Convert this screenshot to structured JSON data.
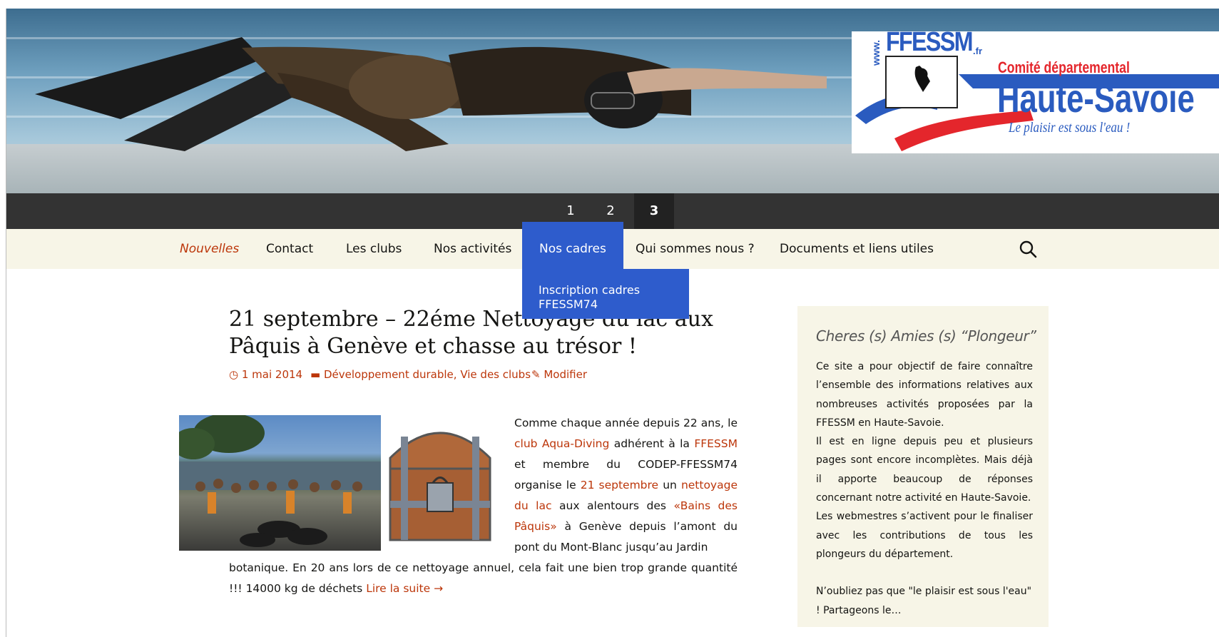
{
  "header": {
    "logo": {
      "brand": "FFESSM",
      "brand_suffix": ".fr",
      "www": "www.",
      "committee": "Comité départemental",
      "region": "Haute-Savoie",
      "slogan": "Le plaisir est sous l'eau !"
    }
  },
  "slider": {
    "pages": [
      "1",
      "2",
      "3"
    ],
    "active_index": 2
  },
  "nav": {
    "items": [
      {
        "label": "Nouvelles"
      },
      {
        "label": "Contact"
      },
      {
        "label": "Les clubs"
      },
      {
        "label": "Nos activités"
      },
      {
        "label": "Nos cadres"
      },
      {
        "label": "Qui sommes nous ?"
      },
      {
        "label": "Documents et liens utiles"
      }
    ],
    "dropdown": {
      "items": [
        {
          "label": "Inscription cadres FFESSM74"
        }
      ]
    }
  },
  "article": {
    "title": "21 septembre – 22éme Nettoyage du lac aux Pâquis à Genève et chasse au trésor !",
    "date": "1 mai 2014",
    "categories": [
      "Développement durable",
      "Vie des clubs"
    ],
    "edit_label": "Modifier",
    "text": {
      "p1": "Comme chaque année depuis 22 ans, le",
      "club_link": "club Aqua-Diving",
      "p2": " adhérent à la ",
      "ffessm_link": "FFESSM",
      "p3": " et membre du CODEP-FFESSM74 organise le ",
      "date_link": "21 septembre",
      "p4": " un ",
      "nettoyage_link": "nettoyage du lac",
      "p5": " aux alentours des ",
      "bains_link": "«Bains des Pâquis»",
      "p6": " à Genève depuis l’amont du pont du Mont-Blanc jusqu’au Jardin",
      "p7": "botanique. En 20 ans lors de ce nettoyage annuel, cela fait une bien trop grande quantité !!! 14000 kg de déchets ",
      "read_more": "Lire la suite →"
    }
  },
  "sidebar": {
    "title": "Cheres (s) Amies (s) “Plongeur”",
    "paragraphs": [
      "Ce site a pour objectif de faire connaître l’ensemble des informations relatives aux nombreuses activités proposées par la FFESSM en Haute-Savoie.",
      "Il est en ligne depuis peu et plusieurs pages sont encore incomplètes. Mais déjà il apporte beaucoup de réponses concernant notre activité en Haute-Savoie.",
      "Les webmestres s’activent pour le finaliser avec les contributions de tous les plongeurs du département.",
      "N’oubliez pas que \"le plaisir est sous l'eau\" ! Partageons le…"
    ]
  },
  "colors": {
    "accent": "#bc360a",
    "nav_bg": "#f7f5e7",
    "slider_bg": "#333333",
    "dropdown_bg": "#2e5ccc"
  },
  "icons": {
    "search": "search-icon",
    "clock": "clock-icon",
    "folder": "folder-icon",
    "pencil": "pencil-icon"
  }
}
